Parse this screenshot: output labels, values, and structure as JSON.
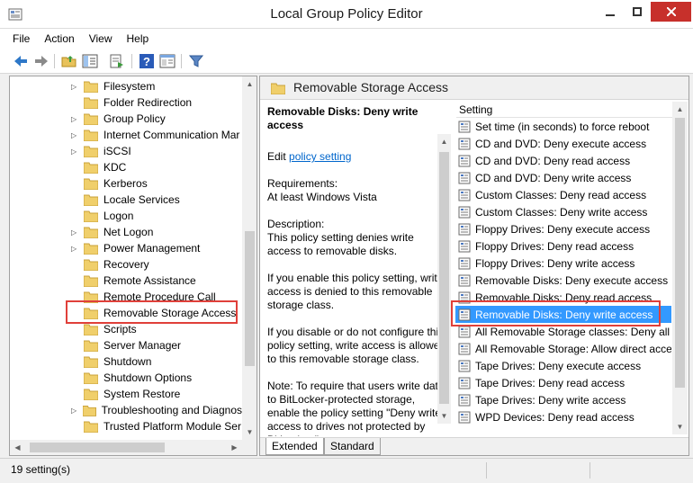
{
  "window": {
    "title": "Local Group Policy Editor"
  },
  "menu": [
    "File",
    "Action",
    "View",
    "Help"
  ],
  "tree": {
    "items": [
      {
        "label": "Filesystem",
        "expandable": true
      },
      {
        "label": "Folder Redirection",
        "expandable": false
      },
      {
        "label": "Group Policy",
        "expandable": true
      },
      {
        "label": "Internet Communication Mar",
        "expandable": true
      },
      {
        "label": "iSCSI",
        "expandable": true
      },
      {
        "label": "KDC",
        "expandable": false
      },
      {
        "label": "Kerberos",
        "expandable": false
      },
      {
        "label": "Locale Services",
        "expandable": false
      },
      {
        "label": "Logon",
        "expandable": false
      },
      {
        "label": "Net Logon",
        "expandable": true
      },
      {
        "label": "Power Management",
        "expandable": true
      },
      {
        "label": "Recovery",
        "expandable": false
      },
      {
        "label": "Remote Assistance",
        "expandable": false
      },
      {
        "label": "Remote Procedure Call",
        "expandable": false
      },
      {
        "label": "Removable Storage Access",
        "expandable": false
      },
      {
        "label": "Scripts",
        "expandable": false
      },
      {
        "label": "Server Manager",
        "expandable": false
      },
      {
        "label": "Shutdown",
        "expandable": false
      },
      {
        "label": "Shutdown Options",
        "expandable": false
      },
      {
        "label": "System Restore",
        "expandable": false
      },
      {
        "label": "Troubleshooting and Diagnos",
        "expandable": true
      },
      {
        "label": "Trusted Platform Module Ser",
        "expandable": false
      }
    ]
  },
  "right": {
    "header": "Removable Storage Access",
    "description": {
      "heading": "Removable Disks: Deny write access",
      "edit_prefix": "Edit",
      "edit_link": "policy setting",
      "requirements_label": "Requirements:",
      "requirements_value": "At least Windows Vista",
      "description_label": "Description:",
      "description_text": "This policy setting denies write access to removable disks.",
      "p_enable": "If you enable this policy setting, write access is denied to this removable storage class.",
      "p_disable": "If you disable or do not configure this policy setting, write access is allowed to this removable storage class.",
      "p_note": "Note: To require that users write data to BitLocker-protected storage, enable the policy setting \"Deny write access to drives not protected by BitLocker,\""
    },
    "list_header": "Setting",
    "settings": [
      "Set time (in seconds) to force reboot",
      "CD and DVD: Deny execute access",
      "CD and DVD: Deny read access",
      "CD and DVD: Deny write access",
      "Custom Classes: Deny read access",
      "Custom Classes: Deny write access",
      "Floppy Drives: Deny execute access",
      "Floppy Drives: Deny read access",
      "Floppy Drives: Deny write access",
      "Removable Disks: Deny execute access",
      "Removable Disks: Deny read access",
      "Removable Disks: Deny write access",
      "All Removable Storage classes: Deny all ac",
      "All Removable Storage: Allow direct acces",
      "Tape Drives: Deny execute access",
      "Tape Drives: Deny read access",
      "Tape Drives: Deny write access",
      "WPD Devices: Deny read access"
    ],
    "selected_index": 11,
    "tabs": [
      "Extended",
      "Standard"
    ]
  },
  "status": {
    "text": "19 setting(s)"
  },
  "colors": {
    "selection": "#3399ff",
    "highlight_box": "#e0403a",
    "close_button": "#c7302b",
    "link": "#0066cc"
  }
}
